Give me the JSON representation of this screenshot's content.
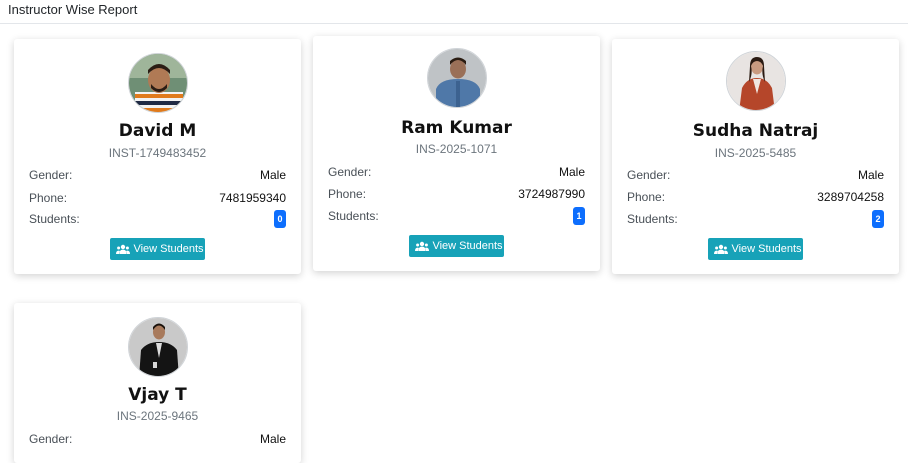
{
  "header": {
    "title": "Instructor Wise Report"
  },
  "labels": {
    "gender": "Gender:",
    "phone": "Phone:",
    "students": "Students:",
    "view_button": "View Students"
  },
  "colors": {
    "button": "#17a2b8",
    "badge": "#0d6efd"
  },
  "instructors": [
    {
      "name": "David M",
      "code": "INST-1749483452",
      "gender": "Male",
      "phone": "7481959340",
      "students": "0"
    },
    {
      "name": "Ram Kumar",
      "code": "INS-2025-1071",
      "gender": "Male",
      "phone": "3724987990",
      "students": "1"
    },
    {
      "name": "Sudha Natraj",
      "code": "INS-2025-5485",
      "gender": "Male",
      "phone": "3289704258",
      "students": "2"
    },
    {
      "name": "Vjay T",
      "code": "INS-2025-9465",
      "gender": "Male"
    }
  ]
}
